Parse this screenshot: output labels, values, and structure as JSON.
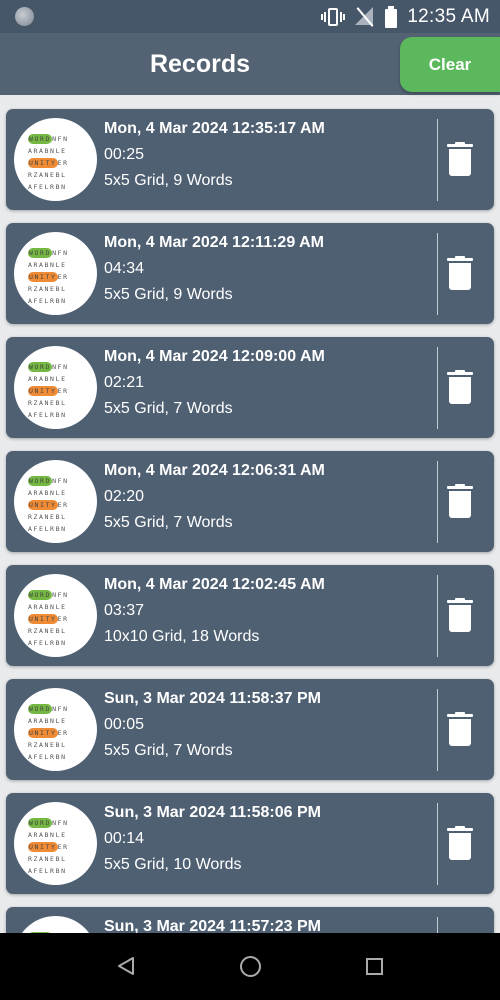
{
  "status_bar": {
    "time": "12:35 AM",
    "icons": [
      "notification-dot-icon",
      "vibrate-icon",
      "no-signal-icon",
      "battery-icon"
    ]
  },
  "app_bar": {
    "title": "Records",
    "clear_label": "Clear",
    "colors": {
      "bar": "#536373",
      "clear_button": "#5cb85c"
    }
  },
  "thumbnail": {
    "rows": [
      {
        "highlight": "WORD",
        "rest": "NFN",
        "color": "green"
      },
      {
        "highlight": "",
        "rest": "ARABNLE",
        "color": ""
      },
      {
        "highlight": "UNITY",
        "rest": "ER",
        "color": "orange"
      },
      {
        "highlight": "",
        "rest": "RZANEBL",
        "color": ""
      },
      {
        "highlight": "",
        "rest": "AFELRBN",
        "color": ""
      }
    ]
  },
  "records": [
    {
      "date": "Mon, 4 Mar 2024 12:35:17 AM",
      "duration": "00:25",
      "grid": "5x5 Grid, 9 Words"
    },
    {
      "date": "Mon, 4 Mar 2024 12:11:29 AM",
      "duration": "04:34",
      "grid": "5x5 Grid, 9 Words"
    },
    {
      "date": "Mon, 4 Mar 2024 12:09:00 AM",
      "duration": "02:21",
      "grid": "5x5 Grid, 7 Words"
    },
    {
      "date": "Mon, 4 Mar 2024 12:06:31 AM",
      "duration": "02:20",
      "grid": "5x5 Grid, 7 Words"
    },
    {
      "date": "Mon, 4 Mar 2024 12:02:45 AM",
      "duration": "03:37",
      "grid": "10x10 Grid, 18 Words"
    },
    {
      "date": "Sun, 3 Mar 2024 11:58:37 PM",
      "duration": "00:05",
      "grid": "5x5 Grid, 7 Words"
    },
    {
      "date": "Sun, 3 Mar 2024 11:58:06 PM",
      "duration": "00:14",
      "grid": "5x5 Grid, 10 Words"
    },
    {
      "date": "Sun, 3 Mar 2024 11:57:23 PM",
      "duration": "",
      "grid": ""
    }
  ],
  "nav_bar": {
    "icons": [
      "back-icon",
      "home-icon",
      "recents-icon"
    ]
  }
}
